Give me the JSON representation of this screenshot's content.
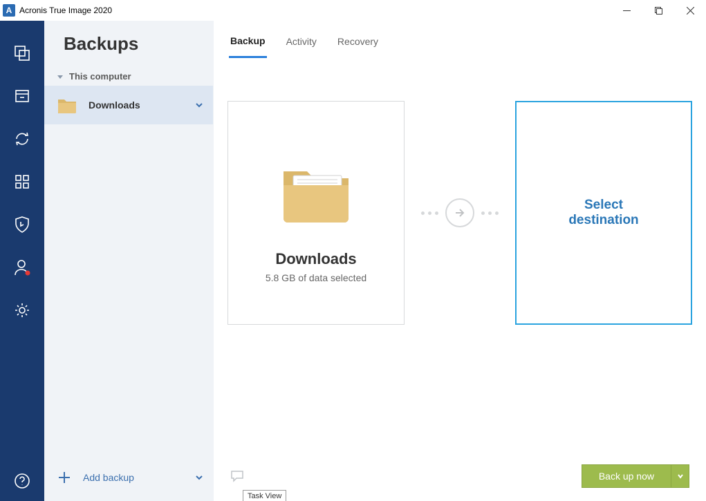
{
  "window_title": "Acronis True Image 2020",
  "app_icon_letter": "A",
  "sidebar": {
    "title": "Backups",
    "group": "This computer",
    "items": [
      {
        "label": "Downloads"
      }
    ],
    "add_label": "Add backup"
  },
  "tabs": {
    "backup": "Backup",
    "activity": "Activity",
    "recovery": "Recovery"
  },
  "source": {
    "title": "Downloads",
    "subtitle": "5.8 GB of data selected"
  },
  "destination": {
    "line1": "Select",
    "line2": "destination"
  },
  "footer": {
    "backup_now": "Back up now"
  },
  "tooltip": "Task View"
}
